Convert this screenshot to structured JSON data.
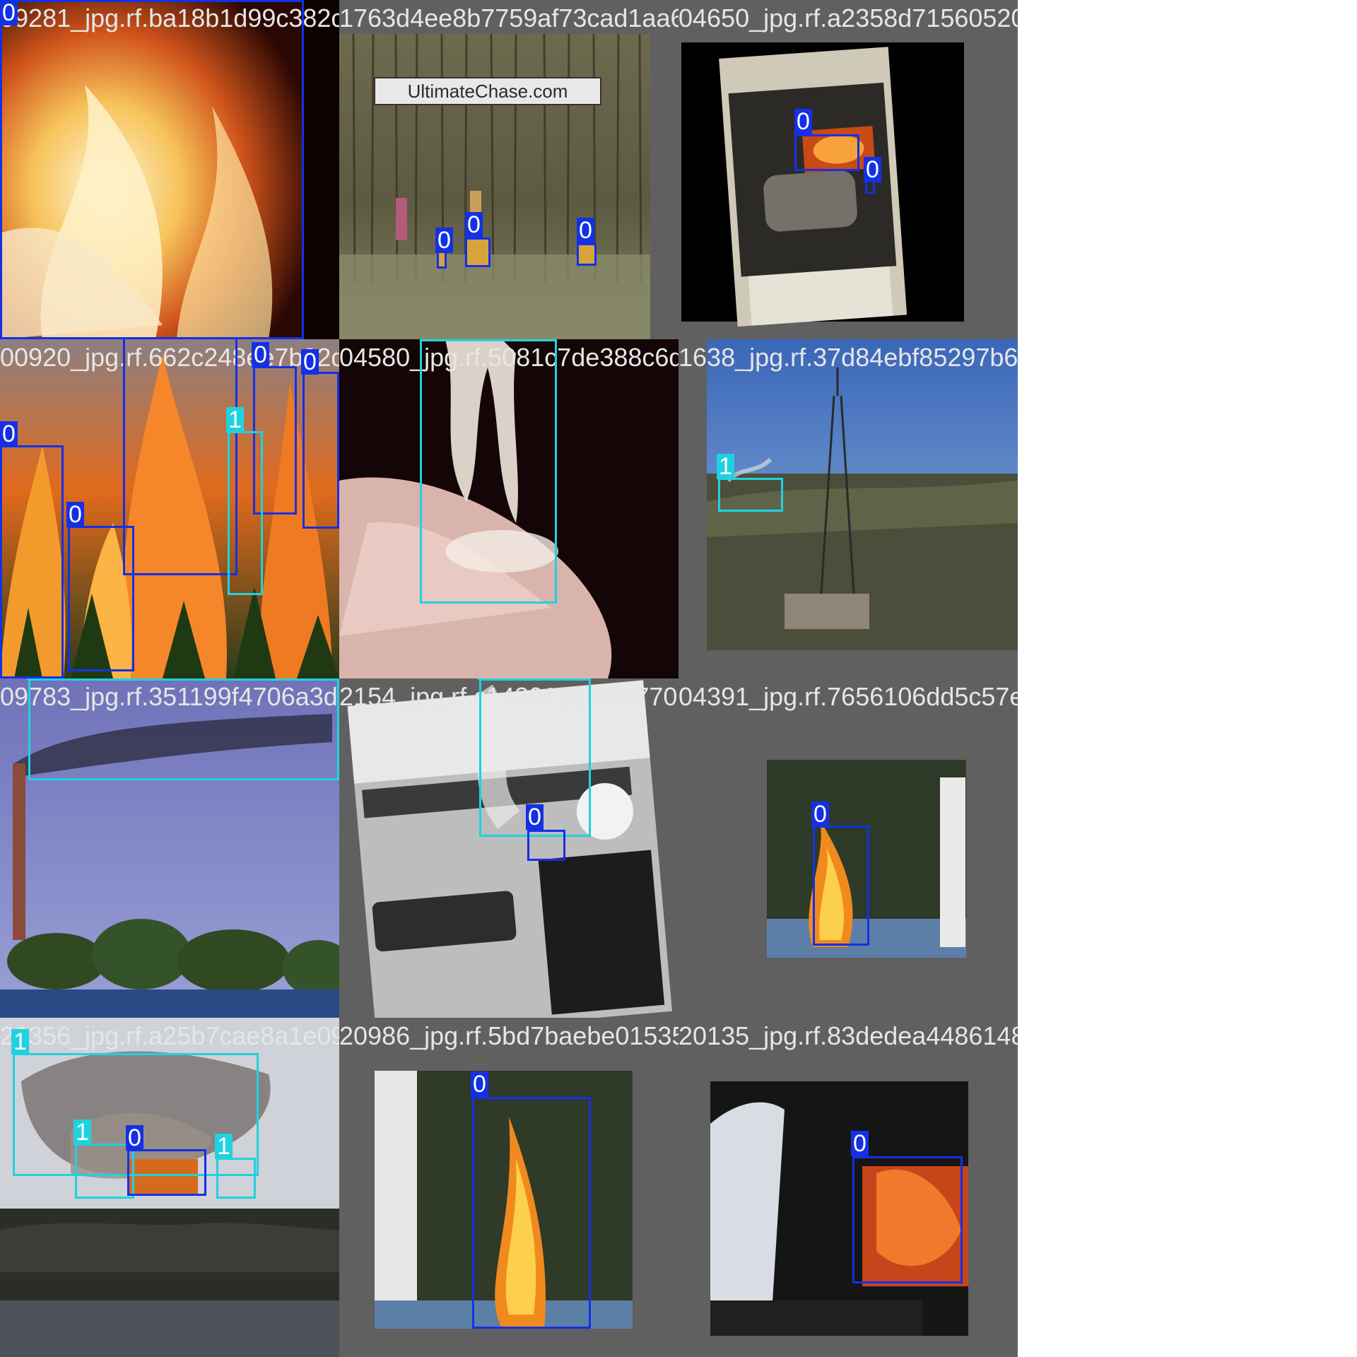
{
  "class_colors": {
    "0": "#1430e6",
    "1": "#1fd2e0"
  },
  "tiles": [
    {
      "filename": "09281_jpg.rf.ba18b1d99c382c0631dd0ef8fd3fe6a5",
      "boxes": [
        {
          "cls": "0"
        }
      ]
    },
    {
      "filename": "1763d4ee8b7759af73cad1aa6e6ec8c125c120",
      "sign": "UltimateChase.com",
      "boxes": [
        {
          "cls": "0"
        },
        {
          "cls": "0"
        },
        {
          "cls": "0"
        }
      ]
    },
    {
      "filename": "04650_jpg.rf.a2358d71560520b6fe953d767ef",
      "boxes": [
        {
          "cls": "0"
        },
        {
          "cls": "0"
        }
      ]
    },
    {
      "filename": "00920_jpg.rf.662c248ee7b02d920b1d3d9f7a1a1a",
      "boxes": [
        {
          "cls": "0"
        },
        {
          "cls": "0"
        },
        {
          "cls": "0"
        },
        {
          "cls": "0"
        },
        {
          "cls": "1"
        },
        {
          "cls": "0"
        }
      ]
    },
    {
      "filename": "04580_jpg.rf.5081c7de388c6d13248e2f46f20",
      "boxes": [
        {
          "cls": "1"
        }
      ]
    },
    {
      "filename": "1638_jpg.rf.37d84ebf85297b633488ab9eb9",
      "boxes": [
        {
          "cls": "1"
        }
      ]
    },
    {
      "filename": "09783_jpg.rf.351199f4706a3d104ec6a0b4b7241e350",
      "boxes": [
        {
          "cls": "1"
        }
      ]
    },
    {
      "filename": "2154_jpg.rf.c14391220f7d7708ed04c4c9e",
      "boxes": [
        {
          "cls": "1"
        },
        {
          "cls": "0"
        }
      ]
    },
    {
      "filename": "04391_jpg.rf.7656106dd5c57e4",
      "boxes": [
        {
          "cls": "0"
        }
      ]
    },
    {
      "filename": "20356_jpg.rf.a25b7cae8a1e0983d80326f4e325bd7baebe",
      "boxes": [
        {
          "cls": "1"
        },
        {
          "cls": "1"
        },
        {
          "cls": "0"
        },
        {
          "cls": "1"
        }
      ]
    },
    {
      "filename": "20986_jpg.rf.5bd7baebe015357a0bf83dedea4486",
      "boxes": [
        {
          "cls": "0"
        }
      ]
    },
    {
      "filename": "20135_jpg.rf.83dedea44861489867f60dc3fc7",
      "boxes": [
        {
          "cls": "0"
        }
      ]
    }
  ]
}
